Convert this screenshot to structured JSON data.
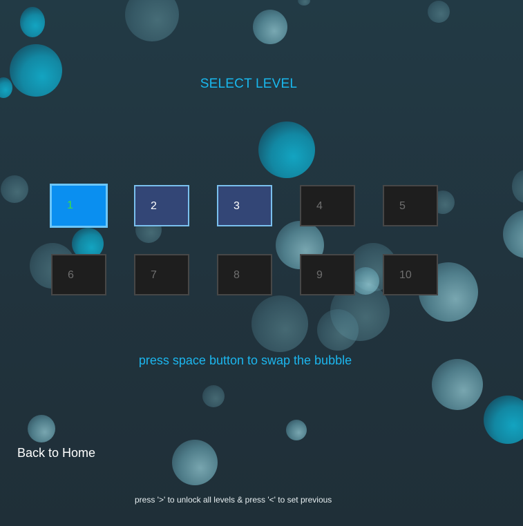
{
  "screen": {
    "title": "SELECT LEVEL",
    "hint": "press space button to swap the bubble",
    "back_label": "Back to Home",
    "footer_note": "press '>' to unlock all levels & press '<' to set previous"
  },
  "levels": [
    {
      "label": "1",
      "state": "selected"
    },
    {
      "label": "2",
      "state": "unlocked"
    },
    {
      "label": "3",
      "state": "unlocked"
    },
    {
      "label": "4",
      "state": "locked"
    },
    {
      "label": "5",
      "state": "locked"
    },
    {
      "label": "6",
      "state": "locked"
    },
    {
      "label": "7",
      "state": "locked"
    },
    {
      "label": "8",
      "state": "locked"
    },
    {
      "label": "9",
      "state": "locked"
    },
    {
      "label": "10",
      "state": "locked"
    }
  ],
  "colors": {
    "accent": "#19b8ee",
    "selected_fill": "#0a8ff0",
    "selected_text": "#3fe03f",
    "unlocked_fill": "#334676",
    "locked_fill": "#1e1e1e"
  }
}
